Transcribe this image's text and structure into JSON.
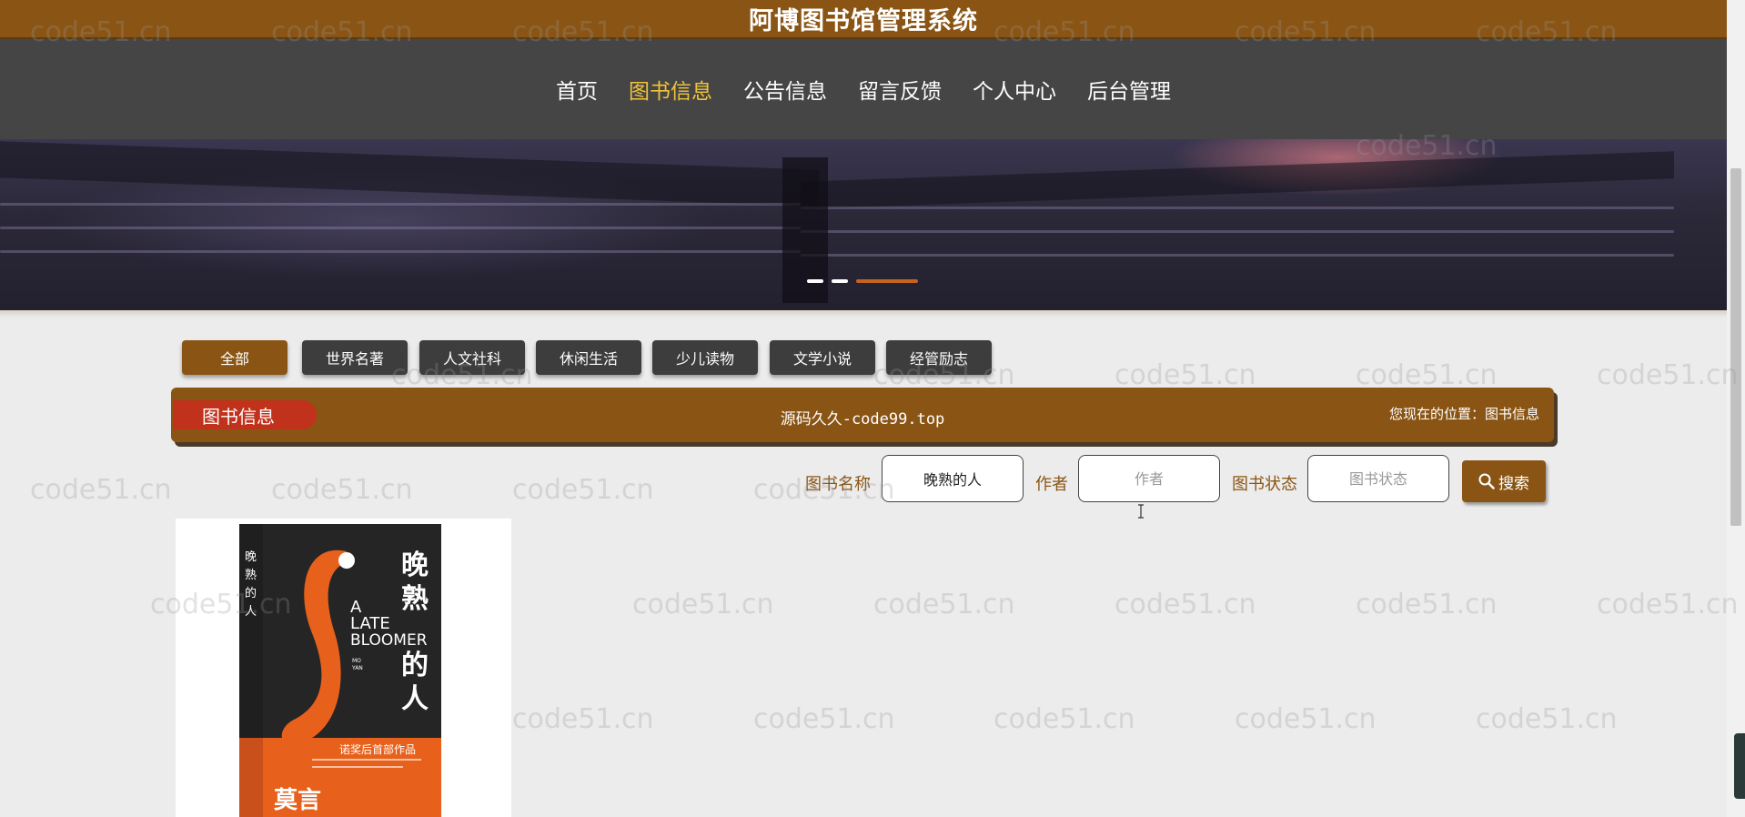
{
  "header": {
    "title": "阿博图书馆管理系统"
  },
  "nav": {
    "items": [
      {
        "label": "首页",
        "active": false
      },
      {
        "label": "图书信息",
        "active": true
      },
      {
        "label": "公告信息",
        "active": false
      },
      {
        "label": "留言反馈",
        "active": false
      },
      {
        "label": "个人中心",
        "active": false
      },
      {
        "label": "后台管理",
        "active": false
      }
    ]
  },
  "banner": {
    "slides": 3,
    "active_slide": 3
  },
  "categories": [
    {
      "label": "全部",
      "active": true
    },
    {
      "label": "世界名著",
      "active": false
    },
    {
      "label": "人文社科",
      "active": false
    },
    {
      "label": "休闲生活",
      "active": false
    },
    {
      "label": "少儿读物",
      "active": false
    },
    {
      "label": "文学小说",
      "active": false
    },
    {
      "label": "经管励志",
      "active": false
    }
  ],
  "section": {
    "tag": "图书信息",
    "center_text": "源码久久-code99.top",
    "location": "您现在的位置：图书信息"
  },
  "search": {
    "name_label": "图书名称",
    "name_value": "晚熟的人",
    "author_label": "作者",
    "author_placeholder": "作者",
    "status_label": "图书状态",
    "status_placeholder": "图书状态",
    "button_label": "搜索"
  },
  "books": [
    {
      "cover_title_cn_1": "晚",
      "cover_title_cn_2": "熟",
      "cover_title_cn_3": "的",
      "cover_title_cn_4": "人",
      "cover_title_en_1": "A",
      "cover_title_en_2": "LATE",
      "cover_title_en_3": "BLOOMER",
      "cover_author_en_1": "MO",
      "cover_author_en_2": "YAN",
      "cover_tagline": "诺奖后首部作品",
      "cover_author_cn": "莫言",
      "spine_text": "晚熟的人"
    }
  ],
  "watermark": "code51.cn",
  "colors": {
    "brand": "#8a5514",
    "nav_bg": "#454545",
    "nav_active": "#f0c33c",
    "tag_red": "#c0321c"
  }
}
